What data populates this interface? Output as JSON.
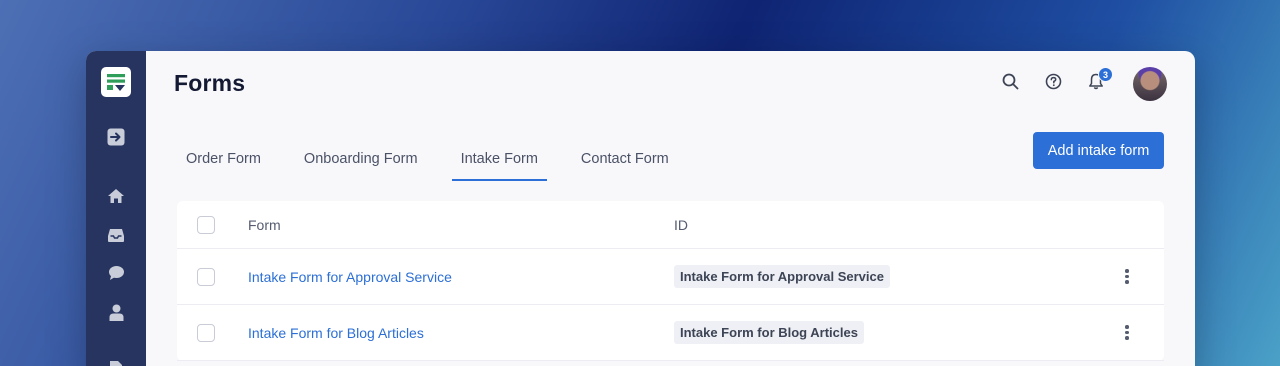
{
  "page": {
    "title": "Forms"
  },
  "header": {
    "notification_count": "3"
  },
  "tabs": [
    {
      "label": "Order Form"
    },
    {
      "label": "Onboarding Form"
    },
    {
      "label": "Intake Form",
      "active": true
    },
    {
      "label": "Contact Form"
    }
  ],
  "actions": {
    "add_label": "Add intake form"
  },
  "table": {
    "columns": {
      "form": "Form",
      "id": "ID"
    },
    "rows": [
      {
        "form": "Intake Form for Approval Service",
        "id": "Intake Form for Approval Service"
      },
      {
        "form": "Intake Form for Blog Articles",
        "id": "Intake Form for Blog Articles"
      }
    ]
  },
  "sidebar": {
    "icons": [
      "logo-icon",
      "collapse-icon",
      "home-icon",
      "inbox-icon",
      "chat-icon",
      "user-icon",
      "document-icon"
    ]
  },
  "colors": {
    "accent": "#2c6fd6",
    "sidebar": "#26345f",
    "page_bg": "#f8f8fb"
  }
}
